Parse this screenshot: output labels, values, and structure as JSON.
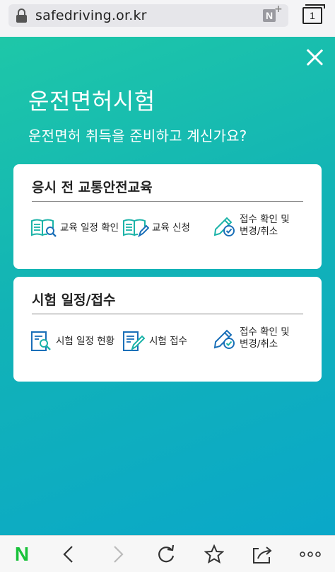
{
  "browser": {
    "url": "safedriving.or.kr",
    "tab_count": "1"
  },
  "page": {
    "title": "운전면허시험",
    "subtitle": "운전면허 취득을 준비하고 계신가요?"
  },
  "cards": [
    {
      "title": "응시 전 교통안전교육",
      "items": [
        {
          "label": "교육 일정 확인",
          "icon": "book-search-icon"
        },
        {
          "label": "교육 신청",
          "icon": "book-pen-icon"
        },
        {
          "label_line1": "접수 확인 및",
          "label_line2": "변경/취소",
          "icon": "pen-check-icon"
        }
      ]
    },
    {
      "title": "시험 일정/접수",
      "items": [
        {
          "label": "시험 일정 현황",
          "icon": "document-search-icon"
        },
        {
          "label": "시험 접수",
          "icon": "document-pen-icon"
        },
        {
          "label_line1": "접수 확인 및",
          "label_line2": "변경/취소",
          "icon": "pen-check-icon"
        }
      ]
    }
  ],
  "nav": {
    "logo": "N"
  },
  "colors": {
    "accent": "#19c23a",
    "gradient_start": "#1ec7a8",
    "gradient_end": "#0aa8c9",
    "icon_teal": "#1bb3a8",
    "icon_blue": "#1a6fb8"
  }
}
